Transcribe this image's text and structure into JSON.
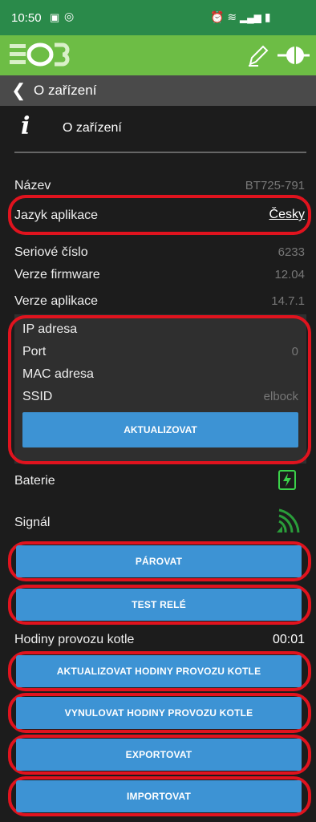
{
  "statusbar": {
    "time": "10:50",
    "left_icons": "gallery-icon, whatsapp-icon",
    "right_icons": "alarm-icon, wifi-icon, volte-icon, signal-icon, battery-icon"
  },
  "appbar": {
    "logo_text": "EOB",
    "brand_color": "#6dbd45"
  },
  "nav": {
    "title": "O zařízení"
  },
  "section": {
    "title": "O zařízení"
  },
  "rows": {
    "name_label": "Název",
    "name_value": "BT725-791",
    "lang_label": "Jazyk aplikace",
    "lang_value": "Česky",
    "serial_label": "Seriové číslo",
    "serial_value": "6233",
    "fw_label": "Verze firmware",
    "fw_value": "12.04",
    "app_label": "Verze aplikace",
    "app_value": "14.7.1"
  },
  "network": {
    "ip_label": "IP adresa",
    "ip_value": "",
    "port_label": "Port",
    "port_value": "0",
    "mac_label": "MAC adresa",
    "mac_value": "",
    "ssid_label": "SSID",
    "ssid_value": "elbock",
    "update_button": "AKTUALIZOVAT"
  },
  "battery": {
    "label": "Baterie"
  },
  "signal": {
    "label": "Signál"
  },
  "buttons": {
    "pair": "PÁROVAT",
    "test_relay": "TEST RELÉ",
    "update_hours": "AKTUALIZOVAT HODINY PROVOZU KOTLE",
    "reset_hours": "VYNULOVAT HODINY PROVOZU KOTLE",
    "export": "EXPORTOVAT",
    "import": "IMPORTOVAT"
  },
  "hours": {
    "label": "Hodiny provozu kotle",
    "value": "00:01"
  },
  "colors": {
    "button_blue": "#3d93d4",
    "highlight_red": "#e0131e",
    "battery_green": "#3bd14a"
  }
}
